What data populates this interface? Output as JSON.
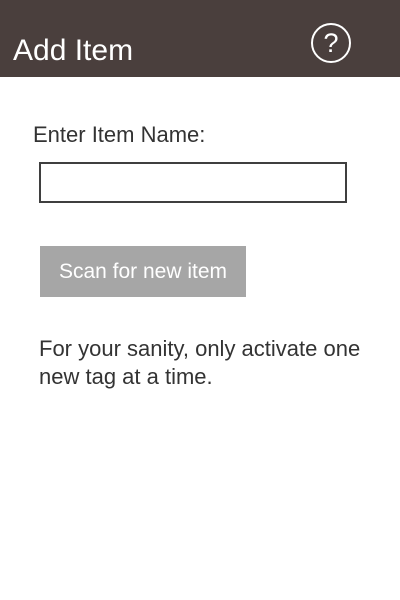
{
  "header": {
    "title": "Add Item",
    "help_icon": "question-circle-icon",
    "help_glyph": "?"
  },
  "form": {
    "name_label": "Enter Item Name:",
    "name_value": "",
    "name_placeholder": "",
    "scan_button_label": "Scan for new item",
    "hint": "For your sanity, only activate one new tag at a time."
  },
  "colors": {
    "header_background": "#4a3f3d",
    "header_text": "#ffffff",
    "button_background": "#a6a6a6",
    "button_text": "#ffffff",
    "body_text": "#333333"
  }
}
